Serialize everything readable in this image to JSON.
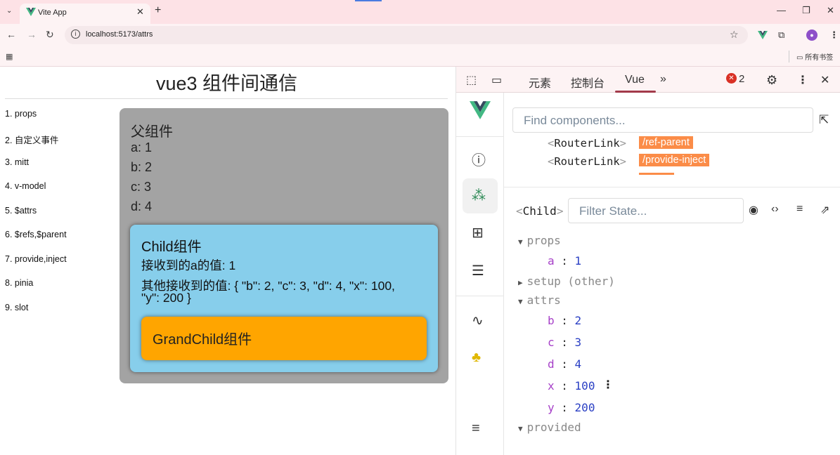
{
  "browser": {
    "tab_title": "Vite App",
    "url": "localhost:5173/attrs",
    "bookmarks_all": "所有书签"
  },
  "page": {
    "title": "vue3 组件间通信",
    "nav": [
      "1. props",
      "2. 自定义事件",
      "3. mitt",
      "4. v-model",
      "5. $attrs",
      "6. $refs,$parent",
      "7. provide,inject",
      "8. pinia",
      "9. slot"
    ],
    "parent": {
      "title": "父组件",
      "lines": [
        "a: 1",
        "b: 2",
        "c: 3",
        "d: 4"
      ]
    },
    "child": {
      "title": "Child组件",
      "line_a": "接收到的a的值: 1",
      "line_other_1": "其他接收到的值: { \"b\": 2, \"c\": 3, \"d\": 4, \"x\": 100,",
      "line_other_2": "\"y\": 200 }"
    },
    "grandchild": {
      "title": "GrandChild组件"
    }
  },
  "devtools": {
    "tabs": [
      "元素",
      "控制台",
      "Vue"
    ],
    "error_count": "2",
    "find_placeholder": "Find components...",
    "router_links": [
      {
        "tag": "RouterLink",
        "route": "/ref-parent"
      },
      {
        "tag": "RouterLink",
        "route": "/provide-inject"
      }
    ],
    "selected_component": "Child",
    "filter_placeholder": "Filter State...",
    "sections": {
      "props": "props",
      "setup": "setup (other)",
      "attrs": "attrs",
      "provided": "provided"
    },
    "props": [
      {
        "key": "a",
        "value": "1"
      }
    ],
    "attrs": [
      {
        "key": "b",
        "value": "2"
      },
      {
        "key": "c",
        "value": "3"
      },
      {
        "key": "d",
        "value": "4"
      },
      {
        "key": "x",
        "value": "100"
      },
      {
        "key": "y",
        "value": "200"
      }
    ],
    "colors": {
      "route_badge": "#fb8c48",
      "vue_green": "#42b883",
      "error_red": "#d93025",
      "key_purple": "#a640c8",
      "value_blue": "#2a3fc4"
    }
  }
}
